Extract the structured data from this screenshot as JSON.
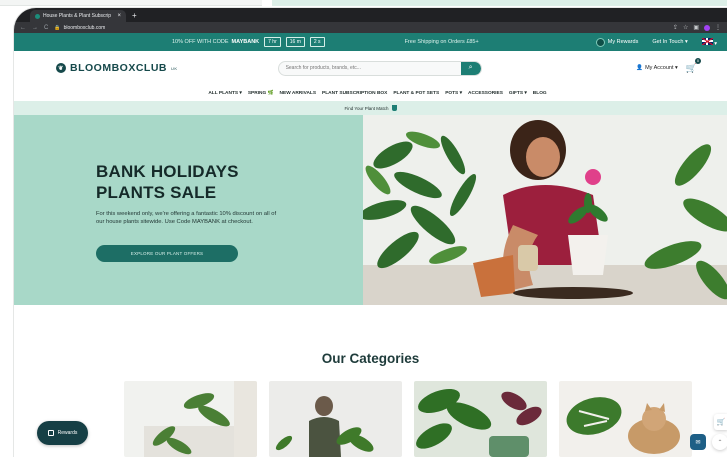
{
  "browser": {
    "tab_title": "House Plants & Plant Subscrip",
    "tab_close": "×",
    "new_tab": "+",
    "url": "bloomboxclub.com",
    "nav_back": "←",
    "nav_forward": "→",
    "nav_reload": "C"
  },
  "promo": {
    "offer_prefix": "10% OFF WITH CODE",
    "code": "MAYBANK",
    "timer": [
      "7 hr",
      "16 m",
      "2 s"
    ],
    "shipping": "Free Shipping on Orders £85+",
    "rewards": "My Rewards",
    "contact": "Get In Touch ▾",
    "flag_caret": "▾"
  },
  "header": {
    "logo_text": "BLOOMBOXCLUB",
    "logo_sup": "UK",
    "search_placeholder": "Search for products, brands, etc...",
    "account": "My Account ▾",
    "cart_count": "0"
  },
  "nav": {
    "items": [
      "ALL PLANTS ▾",
      "SPRING 🌿",
      "NEW ARRIVALS",
      "PLANT SUBSCRIPTION BOX",
      "PLANT & POT SETS",
      "POTS ▾",
      "ACCESSORIES",
      "GIFTS ▾",
      "BLOG"
    ]
  },
  "finder": {
    "label": "Find Your Plant Match"
  },
  "hero": {
    "title_line1": "BANK HOLIDAYS",
    "title_line2": "PLANTS SALE",
    "text": "For this weekend only, we're offering a fantastic 10% discount on all of our house plants sitewide. Use Code MAYBANK at checkout.",
    "cta": "EXPLORE OUR PLANT OFFERS"
  },
  "categories": {
    "title": "Our Categories"
  },
  "floating": {
    "rewards": "Rewards"
  },
  "colors": {
    "brand_teal": "#1d7e74",
    "brand_dark": "#16494b",
    "hero_bg": "#a8d8c8"
  }
}
